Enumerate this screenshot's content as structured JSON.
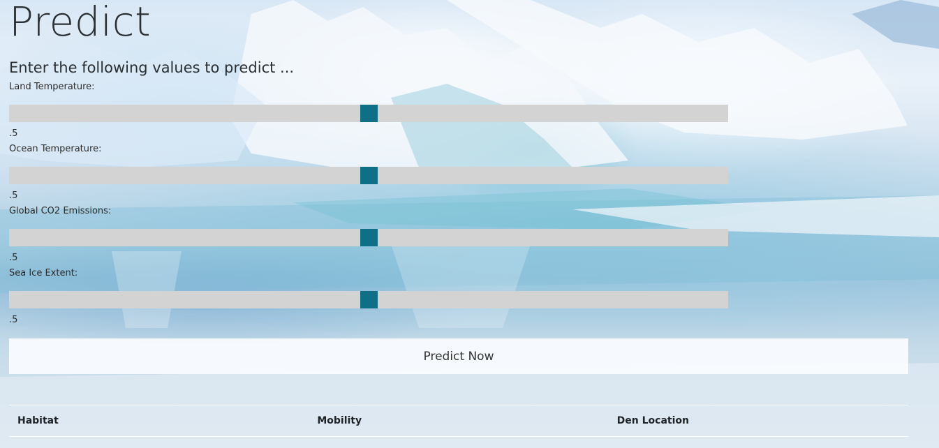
{
  "page": {
    "title": "Predict",
    "subtitle": "Enter the following values to predict ..."
  },
  "form": {
    "fields": [
      {
        "label": "Land Temperature:",
        "value": ".5",
        "level": 0.5
      },
      {
        "label": "Ocean Temperature:",
        "value": ".5",
        "level": 0.5
      },
      {
        "label": "Global CO2 Emissions:",
        "value": ".5",
        "level": 0.5
      },
      {
        "label": "Sea Ice Extent:",
        "value": ".5",
        "level": 0.5
      }
    ],
    "submit_label": "Predict Now"
  },
  "results": {
    "headers": [
      "Habitat",
      "Mobility",
      "Den Location"
    ]
  },
  "colors": {
    "slider_track": "#d3d3d3",
    "slider_thumb": "#0f6f86",
    "text": "#2a2f33"
  },
  "background": "arctic-ice-photo"
}
